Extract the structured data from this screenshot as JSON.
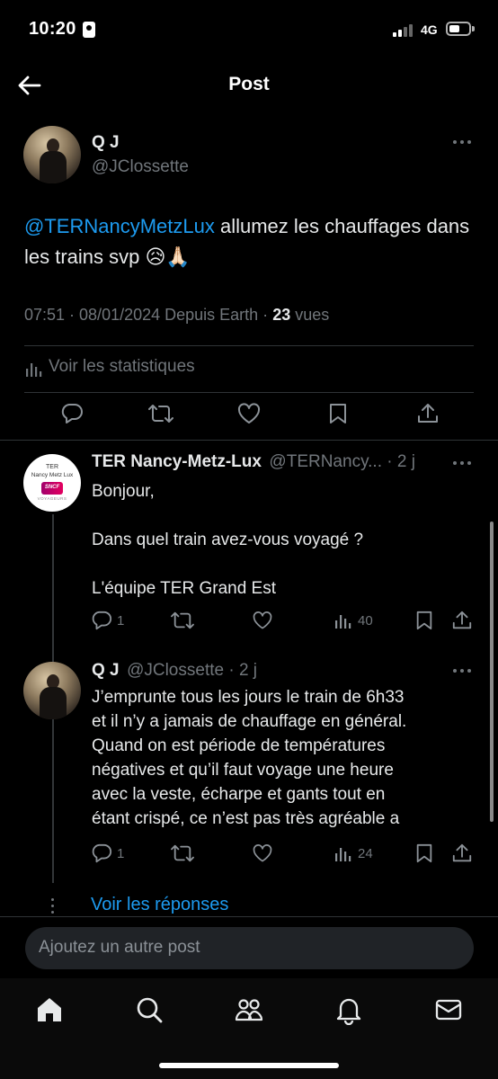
{
  "status_bar": {
    "time": "10:20",
    "network": "4G"
  },
  "header": {
    "title": "Post"
  },
  "post": {
    "name": "Q J",
    "handle": "@JClossette",
    "mention": "@TERNancyMetzLux",
    "text_after_mention": "  allumez les chauffages dans les trains svp 😥🙏🏻",
    "meta_prefix": "07:51 · 08/01/2024 Depuis Earth · ",
    "views_count": "23",
    "views_label": " vues",
    "stats_label": "Voir les statistiques"
  },
  "replies": [
    {
      "name": "TER Nancy-Metz-Lux",
      "handle_time": "@TERNancy... · 2 j",
      "avatar_line1": "TER",
      "avatar_line2": "Nancy Metz Lux",
      "avatar_line3": "VOYAGEURS",
      "body_lines": [
        "Bonjour,",
        "",
        "Dans quel train avez-vous voyagé ?",
        "",
        "L'équipe TER Grand Est"
      ],
      "reply_count": "1",
      "views_count": "40"
    },
    {
      "name": "Q J",
      "handle_time": "@JClossette · 2 j",
      "body_lines": [
        "J’emprunte tous les jours le train de 6h33",
        "et il n’y a jamais de chauffage en général.",
        "Quand on est période de températures",
        "négatives et qu’il faut voyage une heure",
        "avec la veste, écharpe et gants tout en",
        "étant crispé, ce n’est pas très agréable a"
      ],
      "reply_count": "1",
      "views_count": "24"
    }
  ],
  "view_replies": "Voir les réponses",
  "composer": {
    "placeholder": "Ajoutez un autre post"
  },
  "colors": {
    "accent": "#1d9bf0",
    "muted": "#71767b",
    "background": "#000000"
  },
  "icons": [
    "back-arrow-icon",
    "more-icon",
    "stats-icon",
    "reply-icon",
    "retweet-icon",
    "like-icon",
    "bookmark-icon",
    "share-icon",
    "home-icon",
    "search-icon",
    "communities-icon",
    "notifications-icon",
    "messages-icon"
  ]
}
